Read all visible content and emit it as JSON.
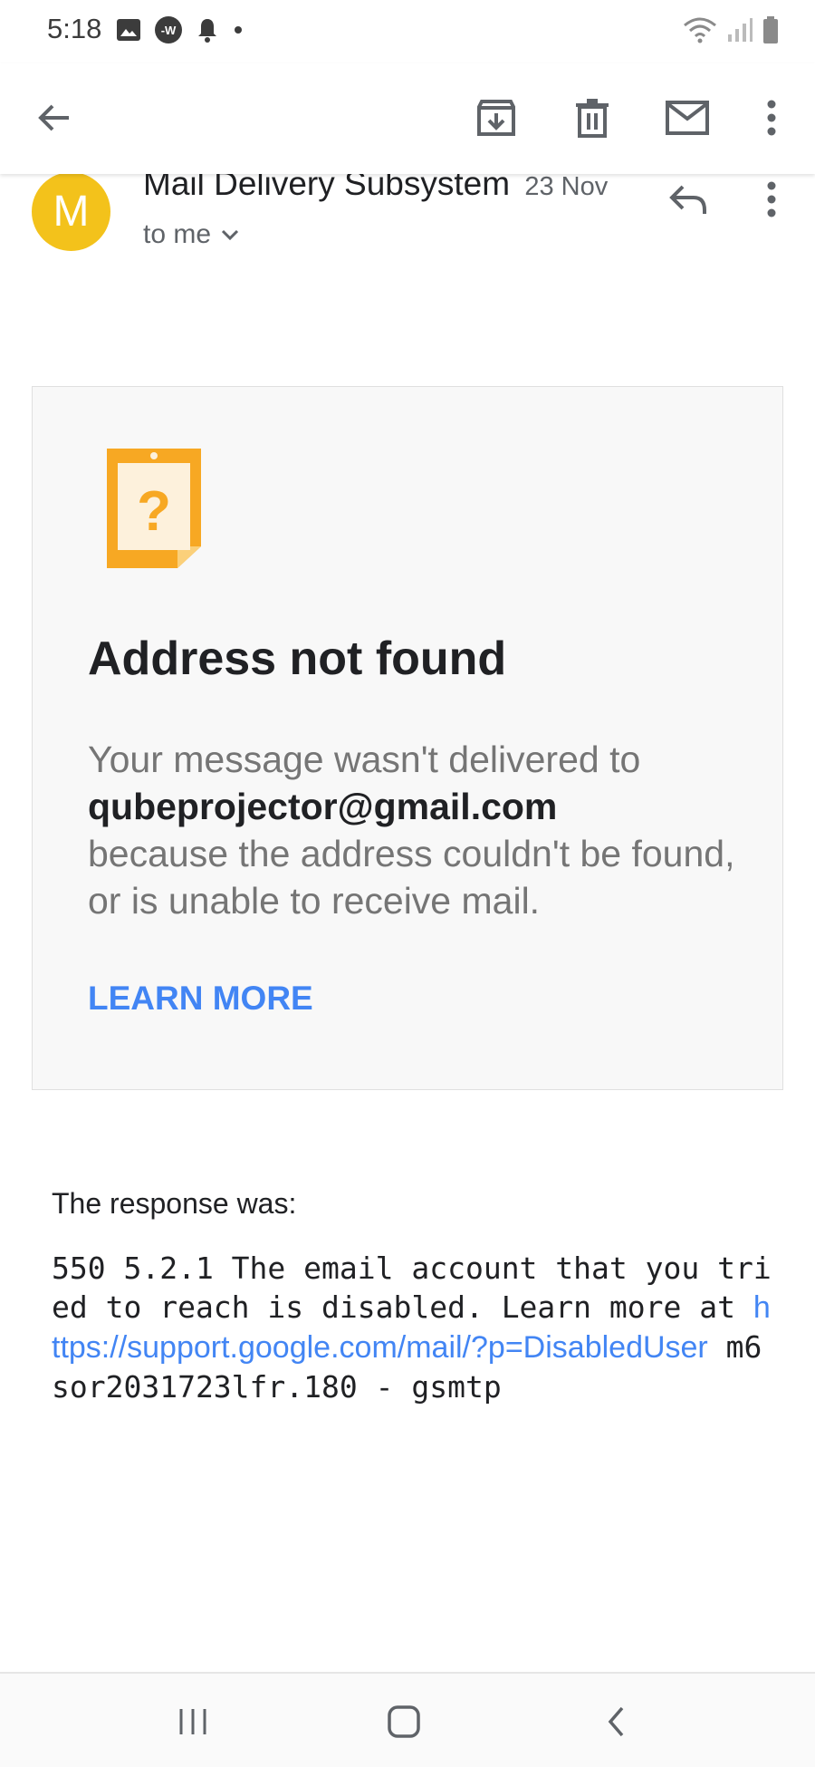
{
  "status_bar": {
    "time": "5:18",
    "left_icons": [
      "image-icon",
      "app-w-icon",
      "bell-icon",
      "dot-icon"
    ],
    "right_icons": [
      "wifi-icon",
      "signal-icon",
      "battery-icon"
    ]
  },
  "toolbar": {
    "back": "arrow-left-icon",
    "actions": [
      "archive-icon",
      "delete-icon",
      "mark-unread-icon",
      "more-vert-icon"
    ]
  },
  "message": {
    "avatar_letter": "M",
    "avatar_color": "#f3c21b",
    "sender": "Mail Delivery Subsystem",
    "date": "23 Nov",
    "recipient": "to me"
  },
  "card": {
    "title": "Address not found",
    "body_intro": "Your message wasn't delivered to",
    "email": "qubeprojector@gmail.com",
    "body_rest": "because the address couldn't be found, or is unable to receive mail.",
    "learn_more": "LEARN MORE",
    "accent_color": "#4285f4"
  },
  "response": {
    "label": "The response was:",
    "text_before": "550 5.2.1 The email account that you tried to reach is disabled. Learn more at ",
    "link": "https://support.google.com/mail/?p=DisabledUser",
    "text_after": " m6sor2031723lfr.180 - gsmtp"
  },
  "nav_bar": {
    "buttons": [
      "recents-icon",
      "home-icon",
      "back-icon"
    ]
  }
}
